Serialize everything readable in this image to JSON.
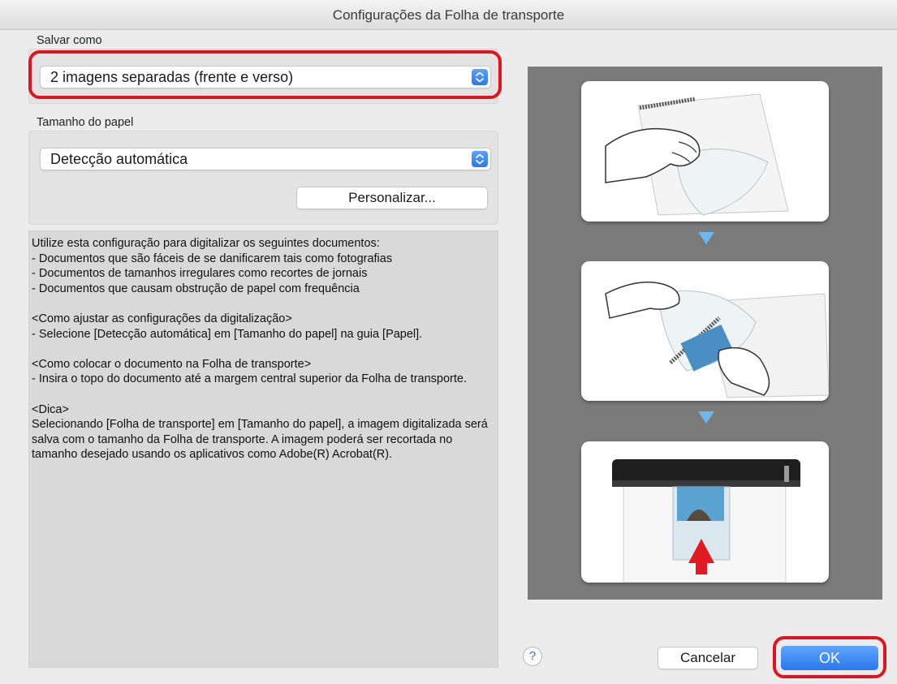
{
  "window": {
    "title": "Configurações da Folha de transporte"
  },
  "save_as": {
    "label": "Salvar como",
    "selected": "2 imagens separadas (frente e verso)"
  },
  "paper_size": {
    "label": "Tamanho do papel",
    "selected": "Detecção automática",
    "customize_button": "Personalizar..."
  },
  "description": {
    "text": "Utilize esta configuração para digitalizar os seguintes documentos:\n- Documentos que são fáceis de se danificarem tais como fotografias\n- Documentos de tamanhos irregulares como recortes de jornais\n- Documentos que causam obstrução de papel com frequência\n\n<Como ajustar as configurações da digitalização>\n- Selecione [Detecção automática] em [Tamanho do papel] na guia [Papel].\n\n<Como colocar o documento na Folha de transporte>\n- Insira o topo do documento até a margem central superior da Folha de transporte.\n\n<Dica>\nSelecionando [Folha de transporte] em [Tamanho do papel], a imagem digitalizada será salva com o tamanho da Folha de transporte. A imagem poderá ser recortada no tamanho desejado usando os aplicativos como Adobe(R) Acrobat(R)."
  },
  "footer": {
    "help_label": "?",
    "cancel_label": "Cancelar",
    "ok_label": "OK"
  },
  "icons": {
    "help": "question-mark-icon",
    "stepper": "up-down-chevron-icon",
    "step_arrow": "triangle-down-icon"
  },
  "colors": {
    "highlight": "#e0141e",
    "accent": "#2a77ef",
    "step_arrow": "#6fb6f0",
    "illustration_bg": "#7b7b7b"
  }
}
